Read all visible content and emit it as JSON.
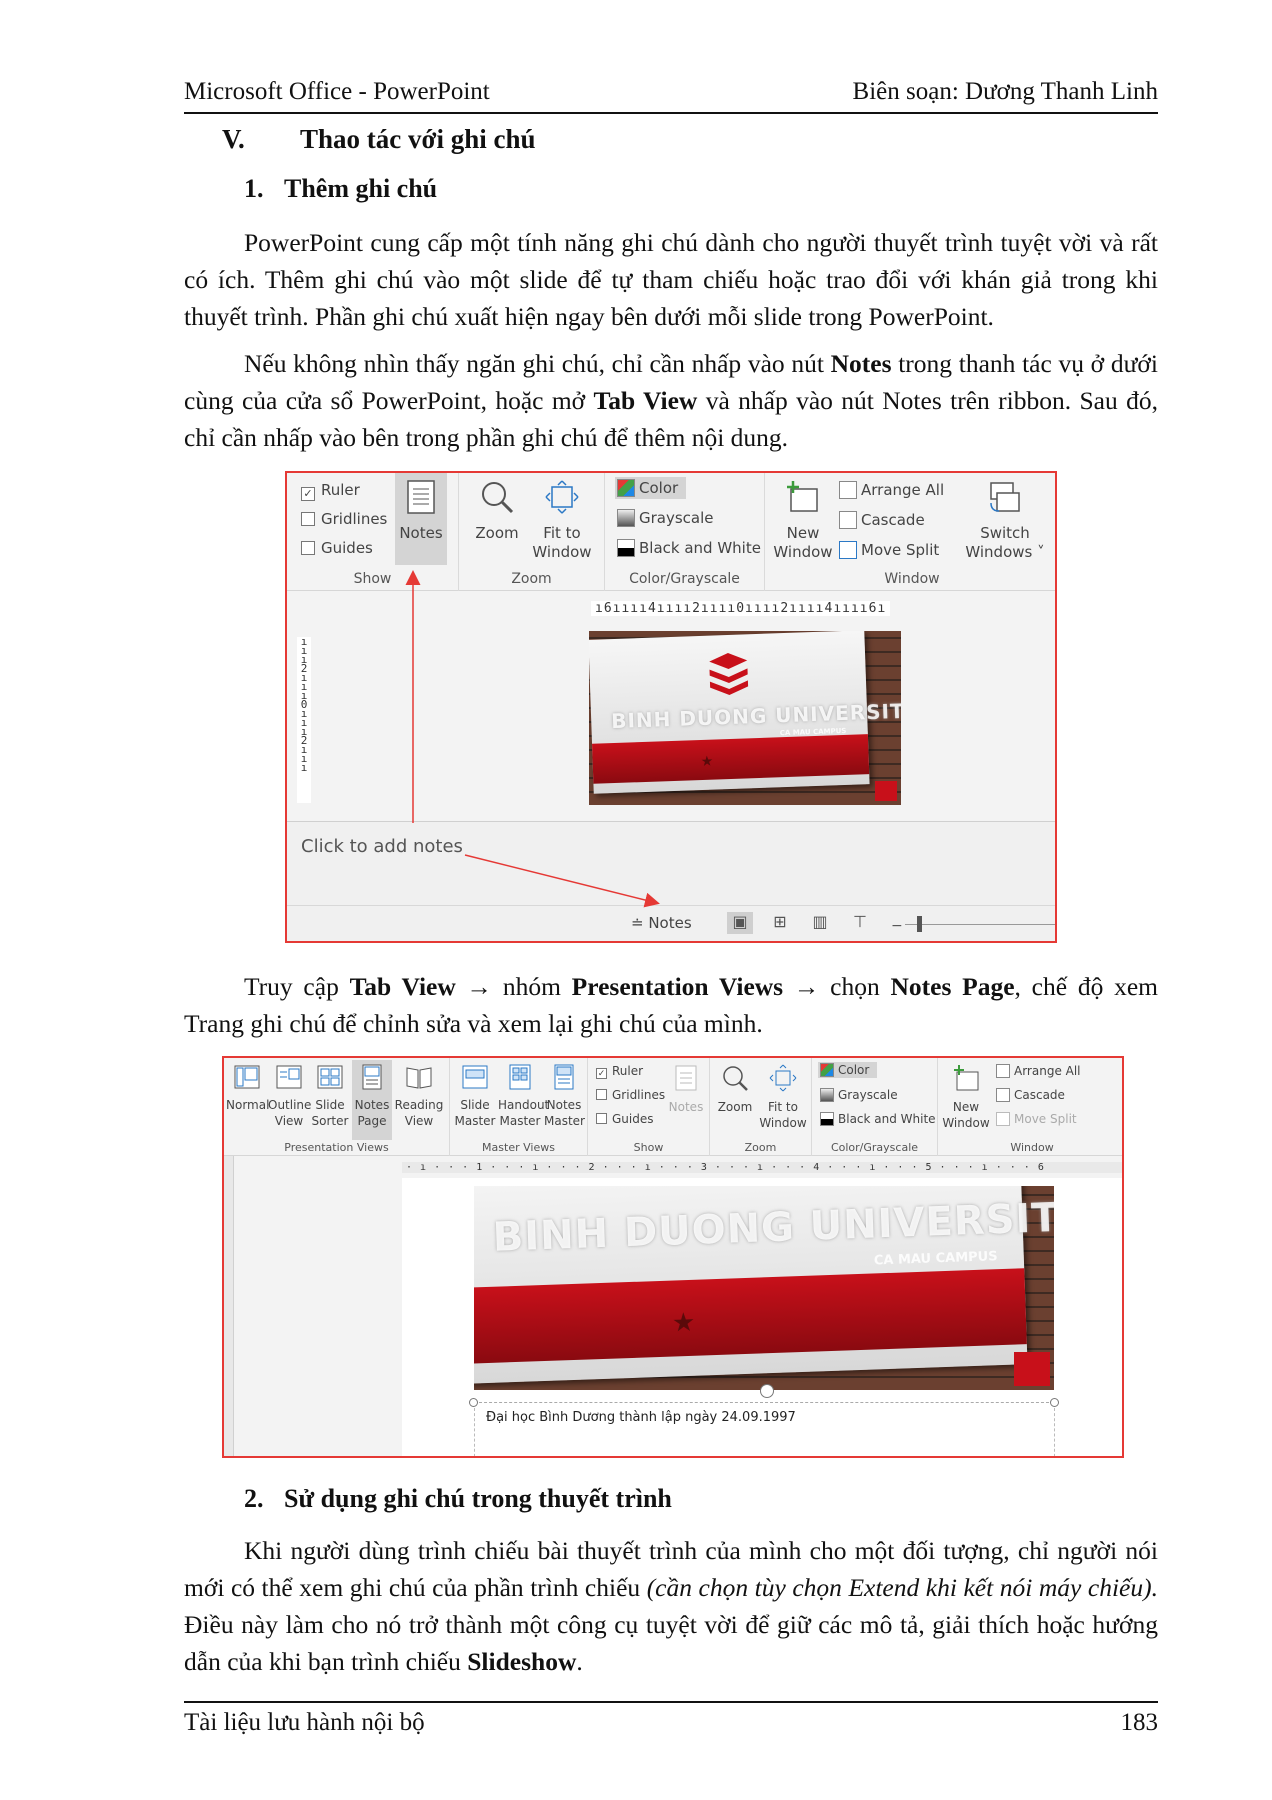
{
  "header": {
    "left": "Microsoft Office - PowerPoint",
    "right": "Biên soạn: Dương Thanh Linh"
  },
  "section": {
    "num": "V.",
    "title": "Thao tác với ghi chú"
  },
  "sub1": {
    "num": "1.",
    "title": "Thêm ghi chú"
  },
  "p1": "PowerPoint cung cấp một tính năng ghi chú dành cho người thuyết trình tuyệt vời và rất có ích. Thêm ghi chú vào một slide để tự tham chiếu hoặc trao đổi với khán giả trong khi thuyết trình. Phần ghi chú xuất hiện ngay bên dưới mỗi slide trong PowerPoint.",
  "p2": {
    "a": "Nếu không nhìn thấy ngăn ghi chú, chỉ cần nhấp vào nút ",
    "b": "Notes",
    "c": " trong thanh tác vụ ở dưới cùng của cửa sổ PowerPoint, hoặc mở ",
    "d": "Tab View",
    "e": " và nhấp vào nút Notes trên ribbon. Sau đó, chỉ cần nhấp vào bên trong phần ghi chú để thêm nội dung."
  },
  "shot1": {
    "show": {
      "ruler": "Ruler",
      "gridlines": "Gridlines",
      "guides": "Guides",
      "notes": "Notes",
      "label": "Show"
    },
    "zoom": {
      "zoom": "Zoom",
      "fit1": "Fit to",
      "fit2": "Window",
      "label": "Zoom"
    },
    "color": {
      "color": "Color",
      "grayscale": "Grayscale",
      "bw": "Black and White",
      "label": "Color/Grayscale"
    },
    "window": {
      "new1": "New",
      "new2": "Window",
      "arrange": "Arrange All",
      "cascade": "Cascade",
      "move": "Move Split",
      "switch1": "Switch",
      "switch2": "Windows ˅",
      "label": "Window"
    },
    "ruler_h": "ı6ıııı4ıııı2ıııı0ıııı2ıııı4ıııı6ı",
    "ruler_v": "ı ı ı 2 ı ı ı 0 ı ı ı 2 ı ı ı",
    "slide_title": "BINH DUONG UNIVERSITY",
    "slide_campus": "CA MAU CAMPUS",
    "notes_placeholder": "Click to add notes",
    "status_notes": "≐ Notes"
  },
  "p3": {
    "a": "Truy cập ",
    "b": "Tab View",
    "c": " → nhóm ",
    "d": "Presentation Views",
    "e": " → chọn ",
    "f": "Notes Page",
    "g": ", chế độ xem Trang ghi chú để chỉnh sửa và xem lại ghi chú của mình."
  },
  "shot2": {
    "pv": {
      "normal": "Normal",
      "outline1": "Outline",
      "outline2": "View",
      "slide1": "Slide",
      "slide2": "Sorter",
      "notes1": "Notes",
      "notes2": "Page",
      "reading1": "Reading",
      "reading2": "View",
      "label": "Presentation Views"
    },
    "mv": {
      "slide1": "Slide",
      "slide2": "Master",
      "handout1": "Handout",
      "handout2": "Master",
      "notes1": "Notes",
      "notes2": "Master",
      "label": "Master Views"
    },
    "show": {
      "ruler": "Ruler",
      "gridlines": "Gridlines",
      "guides": "Guides",
      "notes": "Notes",
      "label": "Show"
    },
    "zoom": {
      "zoom": "Zoom",
      "fit1": "Fit to",
      "fit2": "Window",
      "label": "Zoom"
    },
    "color": {
      "color": "Color",
      "grayscale": "Grayscale",
      "bw": "Black and White",
      "label": "Color/Grayscale"
    },
    "window": {
      "new1": "New",
      "new2": "Window",
      "arrange": "Arrange All",
      "cascade": "Cascade",
      "move": "Move Split",
      "label": "Window"
    },
    "ruler_h": "·  ı  ·  ·  ·  1  ·  ·  ·  ı  ·  ·  ·  2  ·  ·  ·  ı  ·  ·  ·  3  ·  ·  ·  ı  ·  ·  ·  4  ·  ·  ·  ı  ·  ·  ·  5  ·  ·  ·  ı  ·  ·  ·  6",
    "slide_title": "BINH DUONG UNIVERSITY",
    "slide_campus": "CA MAU CAMPUS",
    "note_text": "Đại học Bình Dương thành lập ngày 24.09.1997"
  },
  "sub2": {
    "num": "2.",
    "title": "Sử dụng ghi chú trong thuyết trình"
  },
  "p4": {
    "a": "Khi người dùng trình chiếu bài thuyết trình của mình cho một đối tượng, chỉ người nói mới có thể xem ghi chú của phần trình chiếu ",
    "b": "(cần chọn tùy chọn Extend khi kết nói máy chiếu).",
    "c": " Điều này làm cho nó trở thành một công cụ tuyệt vời để giữ các mô tả, giải thích hoặc hướng dẫn của khi bạn trình chiếu ",
    "d": "Slideshow",
    "e": "."
  },
  "footer": {
    "left": "Tài liệu lưu hành nội bộ",
    "right": "183"
  },
  "colors": {
    "highlight_border": "#e53935",
    "arrow": "#e53935",
    "ribbon_bg": "#f3f3f3",
    "brand_red": "#c8101a"
  }
}
